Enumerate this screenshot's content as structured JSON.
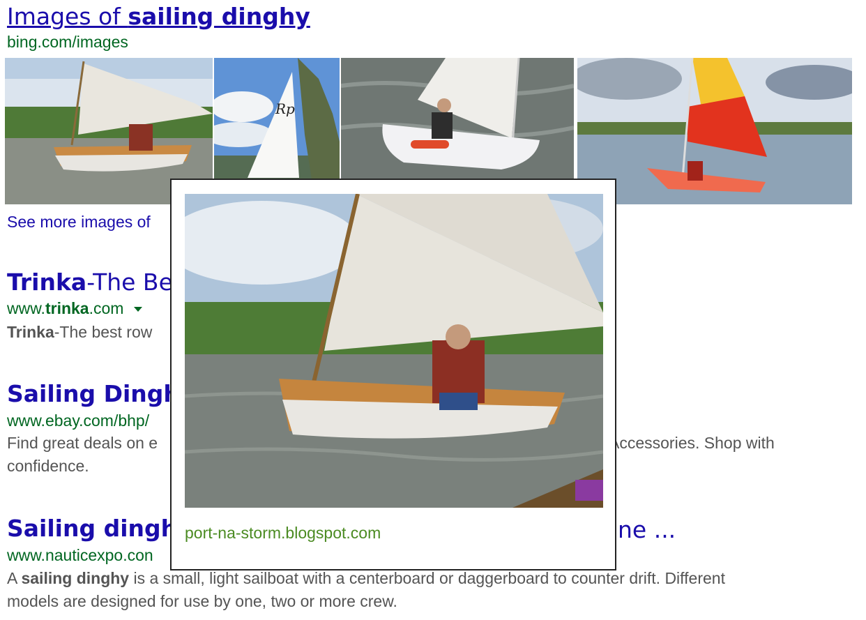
{
  "images_header": {
    "title_prefix": "Images of ",
    "title_bold": "sailing dinghy",
    "source": "bing.com/images",
    "see_more": "See more images of"
  },
  "thumbnails": [
    {
      "name": "wooden catboat on river",
      "icon": "sailboat-photo"
    },
    {
      "name": "white sail with RP logo",
      "icon": "sailboat-photo"
    },
    {
      "name": "man in white dinghy",
      "icon": "sailboat-photo"
    },
    {
      "name": "red and yellow sail dinghy",
      "icon": "sailboat-photo"
    }
  ],
  "results": [
    {
      "title_bold": "Trinka",
      "title_rest": "-The Bes",
      "url_pre": "www.",
      "url_bold": "trinka",
      "url_post": ".com",
      "snippet_bold": "Trinka",
      "snippet_rest": "-The best row"
    },
    {
      "title": "Sailing Dinghy",
      "url": "www.ebay.com/bhp/",
      "snippet_left": "Find great deals on e",
      "snippet_right": "Accessories. Shop with",
      "snippet_line2": "confidence."
    },
    {
      "title_left": "Sailing dinghie",
      "title_right": "ne ...",
      "url": "www.nauticexpo.con",
      "snippet_a": "A ",
      "snippet_bold": "sailing dinghy",
      "snippet_b": " is a small, light sailboat with a centerboard or daggerboard to counter drift. Different",
      "snippet_line2": "models are designed for use by one, two or more crew."
    }
  ],
  "preview": {
    "source": "port-na-storm.blogspot.com"
  },
  "colors": {
    "link": "#1a0dab",
    "url": "#006621",
    "snippet": "#545454",
    "preview_source": "#4b8b22"
  }
}
